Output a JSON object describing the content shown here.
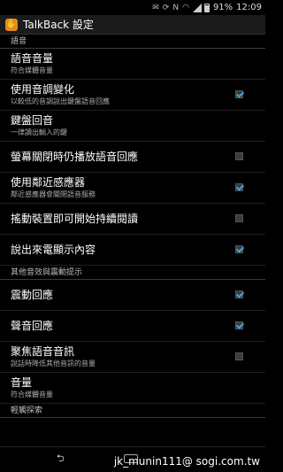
{
  "status_bar": {
    "battery_percent": "91%",
    "time": "12:09",
    "icons": [
      "notification-icon",
      "sync-icon",
      "nfc-icon",
      "wifi-icon",
      "signal-icon",
      "battery-icon"
    ]
  },
  "action_bar": {
    "app_icon": "talkback-hand-icon",
    "title": "TalkBack 設定"
  },
  "sections": {
    "speech": "語音",
    "other_feedback": "其他音效與震動提示",
    "touch_explore": "輕觸探索"
  },
  "items": [
    {
      "title": "語音音量",
      "summary": "符合媒體音量"
    },
    {
      "title": "使用音調變化",
      "summary": "以較低的音調說出鍵盤語音回應",
      "checked": true
    },
    {
      "title": "鍵盤回音",
      "summary": "一律讀出輸入的鍵"
    },
    {
      "title": "螢幕關閉時仍播放語音回應",
      "checked": false
    },
    {
      "title": "使用鄰近感應器",
      "summary": "鄰近感應器會關閉語音服務",
      "checked": true
    },
    {
      "title": "搖動裝置即可開始持續閱讀",
      "checked": false
    },
    {
      "title": "說出來電顯示內容",
      "checked": true
    },
    {
      "title": "震動回應",
      "checked": true
    },
    {
      "title": "聲音回應",
      "checked": true
    },
    {
      "title": "聚焦語音音訊",
      "summary": "說話時降低其他音訊的音量",
      "checked": false
    },
    {
      "title": "音量",
      "summary": "符合媒體音量"
    }
  ],
  "watermark": "jk_munin111@ sogi.com.tw"
}
